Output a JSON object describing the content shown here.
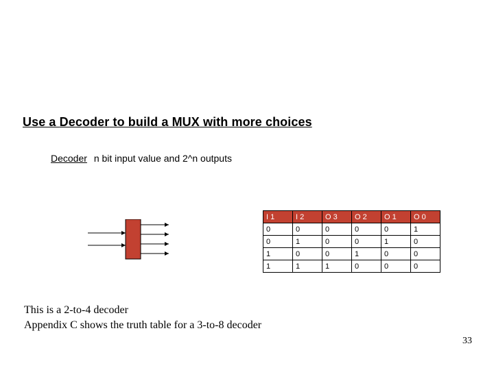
{
  "title": {
    "prefix": "Use a ",
    "keyword": "Decoder",
    "suffix": " to build a MUX with more choices"
  },
  "subline": {
    "keyword": "Decoder",
    "text": "n bit input value and 2^n outputs"
  },
  "table": {
    "headers": [
      "I 1",
      "I 2",
      "O 3",
      "O 2",
      "O 1",
      "O 0"
    ],
    "rows": [
      [
        "0",
        "0",
        "0",
        "0",
        "0",
        "1"
      ],
      [
        "0",
        "1",
        "0",
        "0",
        "1",
        "0"
      ],
      [
        "1",
        "0",
        "0",
        "1",
        "0",
        "0"
      ],
      [
        "1",
        "1",
        "1",
        "0",
        "0",
        "0"
      ]
    ]
  },
  "caption": {
    "line1": "This is a 2-to-4 decoder",
    "line2": "Appendix C shows the truth table for a 3-to-8  decoder"
  },
  "page_number": "33",
  "colors": {
    "accent": "#c24131"
  }
}
